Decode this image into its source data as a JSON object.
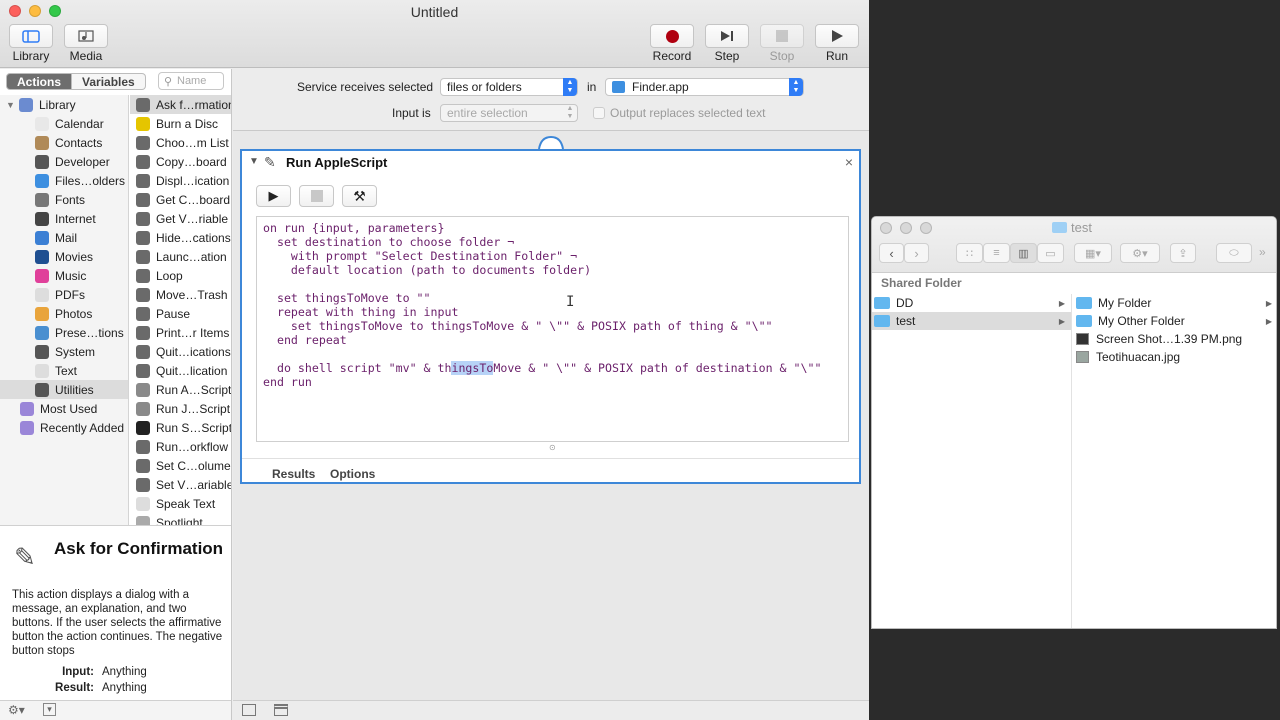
{
  "automator": {
    "title": "Untitled",
    "toolbar": {
      "library": "Library",
      "media": "Media",
      "record": "Record",
      "step": "Step",
      "stop": "Stop",
      "run": "Run"
    },
    "tabs": {
      "actions": "Actions",
      "variables": "Variables"
    },
    "search_placeholder": "Name",
    "library_items": [
      {
        "label": "Library",
        "icon": "library-icon",
        "color": "#6b8bd0"
      },
      {
        "label": "Calendar",
        "icon": "calendar-icon",
        "color": "#e8e8e8"
      },
      {
        "label": "Contacts",
        "icon": "contacts-icon",
        "color": "#b08a58"
      },
      {
        "label": "Developer",
        "icon": "developer-icon",
        "color": "#555555"
      },
      {
        "label": "Files…olders",
        "icon": "finder-icon",
        "color": "#3d8fe0"
      },
      {
        "label": "Fonts",
        "icon": "fonts-icon",
        "color": "#777777"
      },
      {
        "label": "Internet",
        "icon": "internet-icon",
        "color": "#444444"
      },
      {
        "label": "Mail",
        "icon": "mail-icon",
        "color": "#3b7fd4"
      },
      {
        "label": "Movies",
        "icon": "movies-icon",
        "color": "#1f4f91"
      },
      {
        "label": "Music",
        "icon": "music-icon",
        "color": "#e0409a"
      },
      {
        "label": "PDFs",
        "icon": "pdf-icon",
        "color": "#dddddd"
      },
      {
        "label": "Photos",
        "icon": "photos-icon",
        "color": "#e9a43b"
      },
      {
        "label": "Prese…tions",
        "icon": "presentation-icon",
        "color": "#4a8fd0"
      },
      {
        "label": "System",
        "icon": "system-icon",
        "color": "#555555"
      },
      {
        "label": "Text",
        "icon": "text-icon",
        "color": "#dddddd"
      },
      {
        "label": "Utilities",
        "icon": "utilities-icon",
        "color": "#555555"
      },
      {
        "label": "Most Used",
        "icon": "smart-folder-icon",
        "color": "#9a86d8"
      },
      {
        "label": "Recently Added",
        "icon": "smart-folder-icon",
        "color": "#9a86d8"
      }
    ],
    "actions": [
      "Ask f…rmation",
      "Burn a Disc",
      "Choo…m List",
      "Copy…board",
      "Displ…ication",
      "Get C…board",
      "Get V…riable",
      "Hide…cations",
      "Launc…ation",
      "Loop",
      "Move…Trash",
      "Pause",
      "Print…r Items",
      "Quit…ications",
      "Quit…lication",
      "Run A…Script",
      "Run J…Script",
      "Run S…Script",
      "Run…orkflow",
      "Set C…olume",
      "Set V…ariable",
      "Speak Text",
      "Spotlight"
    ],
    "description": {
      "title": "Ask for Confirmation",
      "text": "This action displays a dialog with a message, an explanation, and two buttons. If the user selects the affirmative button the action continues. The negative button stops",
      "input_label": "Input:",
      "input_value": "Anything",
      "result_label": "Result:",
      "result_value": "Anything"
    },
    "service": {
      "receives_label": "Service receives selected",
      "receives_value": "files or folders",
      "in_label": "in",
      "app_value": "Finder.app",
      "input_is_label": "Input is",
      "input_is_value": "entire selection",
      "output_replaces_label": "Output replaces selected text"
    },
    "action_block": {
      "title": "Run AppleScript",
      "results_tab": "Results",
      "options_tab": "Options",
      "code_lines": [
        "on run {input, parameters}",
        "  set destination to choose folder ¬",
        "    with prompt \"Select Destination Folder\" ¬",
        "    default location (path to documents folder)",
        "",
        "  set thingsToMove to \"\"",
        "  repeat with thing in input",
        "    set thingsToMove to thingsToMove & \" \\\"\" & POSIX path of thing & \"\\\"\"",
        "  end repeat",
        "",
        "  do shell script \"mv\" & thingsToMove & \" \\\"\" & POSIX path of destination & \"\\\"\"",
        "end run"
      ]
    }
  },
  "finder": {
    "title": "test",
    "section": "Shared Folder",
    "column1": [
      {
        "name": "DD",
        "type": "folder"
      },
      {
        "name": "test",
        "type": "folder"
      }
    ],
    "column2": [
      {
        "name": "My Folder",
        "type": "folder"
      },
      {
        "name": "My Other Folder",
        "type": "folder"
      },
      {
        "name": "Screen Shot…1.39 PM.png",
        "type": "image"
      },
      {
        "name": "Teotihuacan.jpg",
        "type": "image"
      }
    ]
  }
}
